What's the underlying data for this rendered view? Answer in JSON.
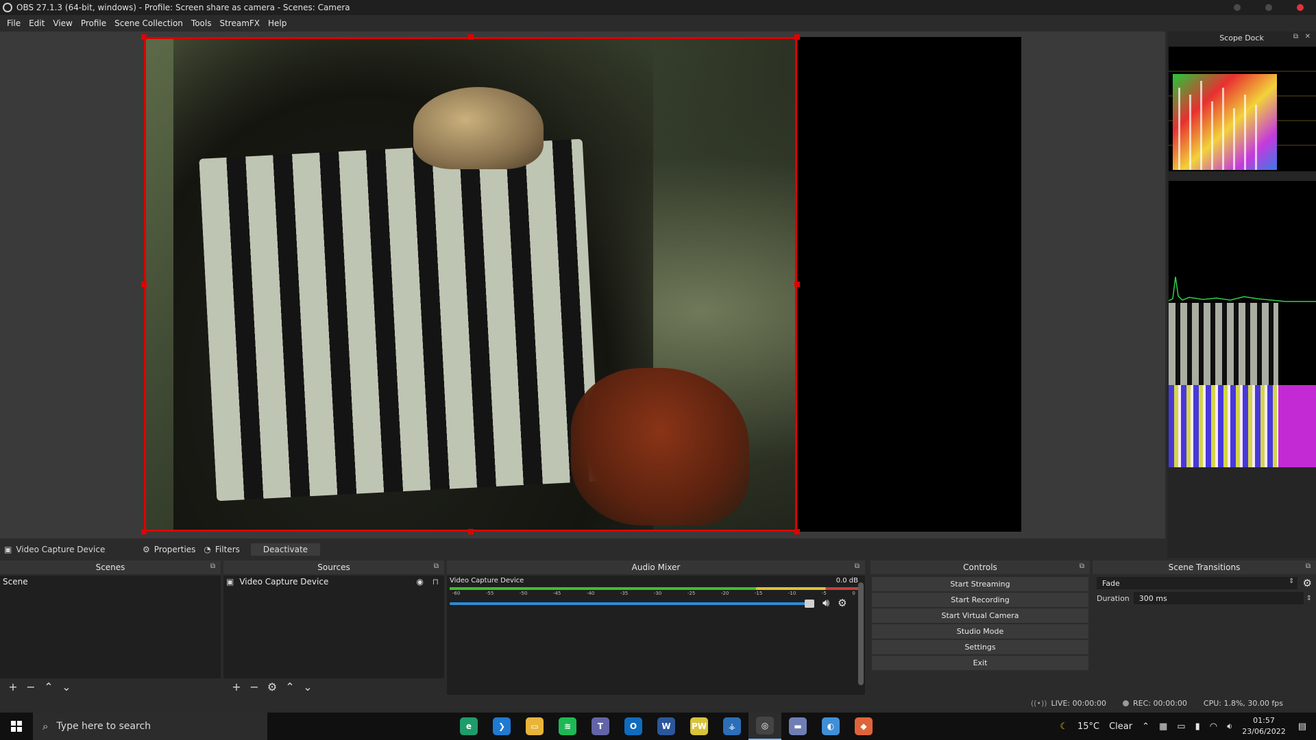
{
  "window": {
    "title": "OBS 27.1.3 (64-bit, windows) - Profile: Screen share as camera - Scenes: Camera"
  },
  "menu": [
    "File",
    "Edit",
    "View",
    "Profile",
    "Scene Collection",
    "Tools",
    "StreamFX",
    "Help"
  ],
  "scope_dock": {
    "title": "Scope Dock"
  },
  "source_toolbar": {
    "source_name": "Video Capture Device",
    "properties_label": "Properties",
    "filters_label": "Filters",
    "deactivate_label": "Deactivate"
  },
  "scenes": {
    "title": "Scenes",
    "items": [
      "Scene"
    ]
  },
  "sources": {
    "title": "Sources",
    "items": [
      "Video Capture Device"
    ]
  },
  "mixer": {
    "title": "Audio Mixer",
    "channel_name": "Video Capture Device",
    "level": "0.0 dB",
    "ticks": [
      "-60",
      "-55",
      "-50",
      "-45",
      "-40",
      "-35",
      "-30",
      "-25",
      "-20",
      "-15",
      "-10",
      "-5",
      "0"
    ],
    "fader_level_fraction": 1.0
  },
  "controls": {
    "title": "Controls",
    "buttons": [
      "Start Streaming",
      "Start Recording",
      "Start Virtual Camera",
      "Studio Mode",
      "Settings",
      "Exit"
    ]
  },
  "transitions": {
    "title": "Scene Transitions",
    "selected": "Fade",
    "duration_label": "Duration",
    "duration_value": "300 ms"
  },
  "status": {
    "live": "LIVE: 00:00:00",
    "rec": "REC: 00:00:00",
    "cpu": "CPU: 1.8%, 30.00 fps"
  },
  "taskbar": {
    "search_placeholder": "Type here to search",
    "apps": [
      {
        "name": "edge-dev-icon",
        "color": "#1e9c6a",
        "glyph": "e"
      },
      {
        "name": "vscode-icon",
        "color": "#1f7ad1",
        "glyph": "❯"
      },
      {
        "name": "file-explorer-icon",
        "color": "#e8b43a",
        "glyph": "▭"
      },
      {
        "name": "spotify-icon",
        "color": "#1db954",
        "glyph": "≋"
      },
      {
        "name": "teams-icon",
        "color": "#6264a7",
        "glyph": "T"
      },
      {
        "name": "outlook-icon",
        "color": "#0f6cbd",
        "glyph": "O"
      },
      {
        "name": "word-icon",
        "color": "#2b579a",
        "glyph": "W"
      },
      {
        "name": "pw-icon",
        "color": "#d9c33a",
        "glyph": "PW"
      },
      {
        "name": "network-app-icon",
        "color": "#2b6fb8",
        "glyph": "⚶"
      },
      {
        "name": "obs-icon",
        "color": "#444444",
        "glyph": "◎"
      },
      {
        "name": "app-icon",
        "color": "#6f7fb5",
        "glyph": "▬"
      },
      {
        "name": "globe-app-icon",
        "color": "#3f8fd8",
        "glyph": "◐"
      },
      {
        "name": "shield-app-icon",
        "color": "#e0643a",
        "glyph": "◆"
      }
    ],
    "weather_temp": "15°C",
    "weather_desc": "Clear",
    "time": "01:57",
    "date": "23/06/2022"
  }
}
